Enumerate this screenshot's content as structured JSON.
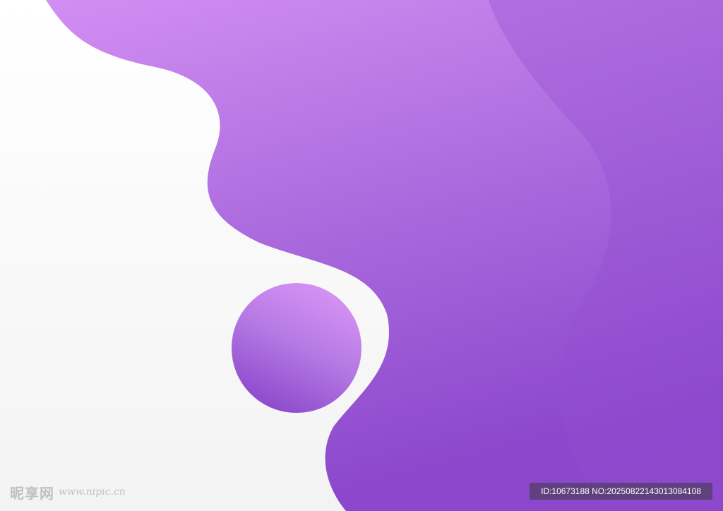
{
  "artwork": {
    "description_colors": {
      "background": "#f6f6f6",
      "purple_light": "#d08ef0",
      "purple_mid": "#ad6ee0",
      "purple_dark": "#8a48cc"
    }
  },
  "watermark": {
    "brand": "昵享网",
    "url": "www.nipic.cn"
  },
  "badge": {
    "text": "ID:10673188 NO:20250822143013084108"
  }
}
